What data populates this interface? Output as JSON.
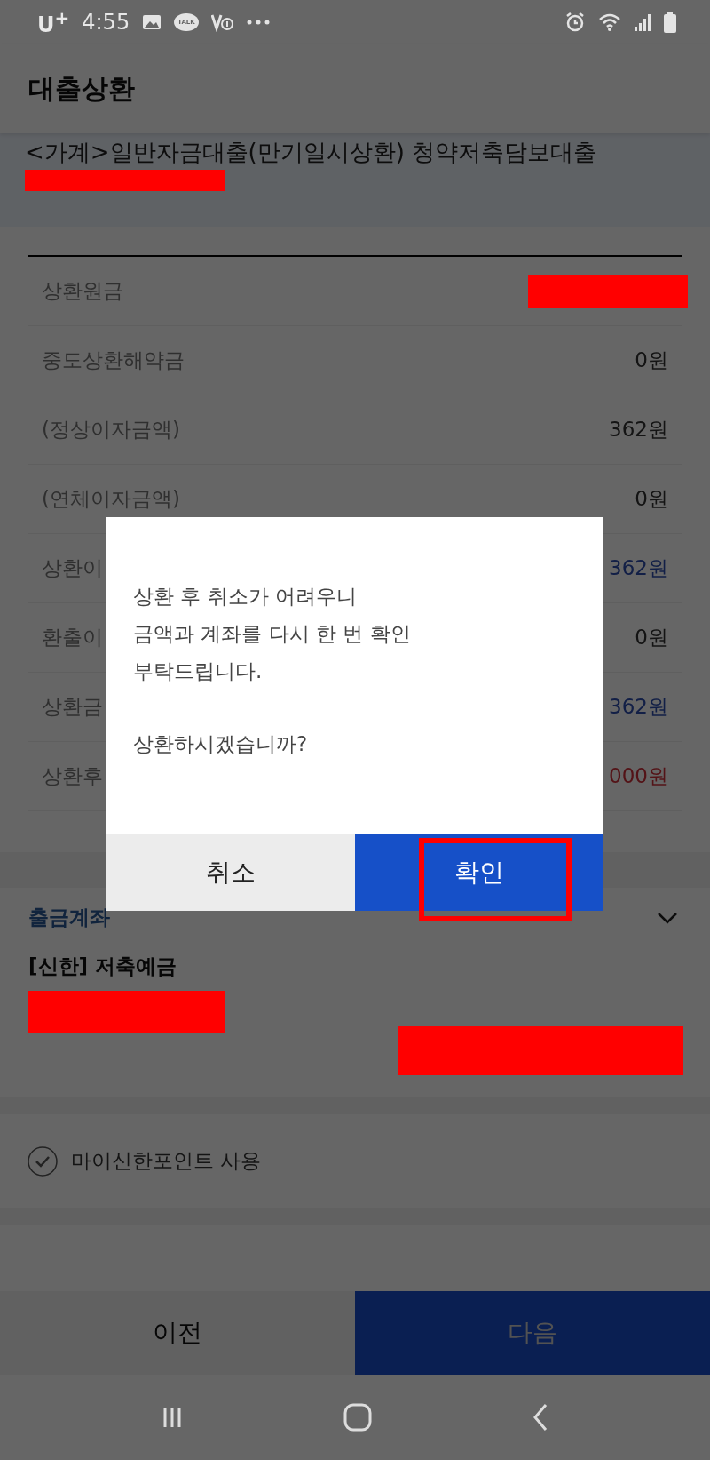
{
  "status_bar": {
    "carrier": "U$^{+}$",
    "time": "4:55",
    "talk_badge": "TALK"
  },
  "app_bar": {
    "title": "대출상환"
  },
  "loan": {
    "name": "<가계>일반자금대출(만기일시상환) 청약저축담보대출"
  },
  "details": [
    {
      "label": "상환원금"
    },
    {
      "label": "중도상환해약금",
      "value": "0원",
      "kind": "plain"
    },
    {
      "label": "(정상이자금액)",
      "value": "362원",
      "kind": "plain"
    },
    {
      "label": "(연체이자금액)",
      "value": "0원",
      "kind": "plain"
    },
    {
      "label": "상환이",
      "value": "362원",
      "kind": "paid"
    },
    {
      "label": "환출이",
      "value": "0원",
      "kind": "plain"
    },
    {
      "label": "상환금",
      "value": "362원",
      "kind": "paid"
    },
    {
      "label": "상환후",
      "value": "000원",
      "kind": "balance"
    }
  ],
  "withdrawal": {
    "label": "출금계좌",
    "account": "[신한] 저축예금"
  },
  "points": {
    "label": "마이신한포인트 사용",
    "checked": false
  },
  "footer": [
    {
      "label": "이전",
      "kind": "secondary"
    },
    {
      "label": "다음",
      "kind": "primary"
    }
  ],
  "dialog": {
    "message_lines": [
      "상환 후 취소가 어려우니",
      "금액과 계좌를 다시 한 번 확인",
      "부탁드립니다."
    ],
    "question": "상환하시겠습니까?",
    "buttons": [
      {
        "label": "취소",
        "kind": "secondary",
        "highlighted": false
      },
      {
        "label": "확인",
        "kind": "primary",
        "highlighted": true
      }
    ]
  }
}
